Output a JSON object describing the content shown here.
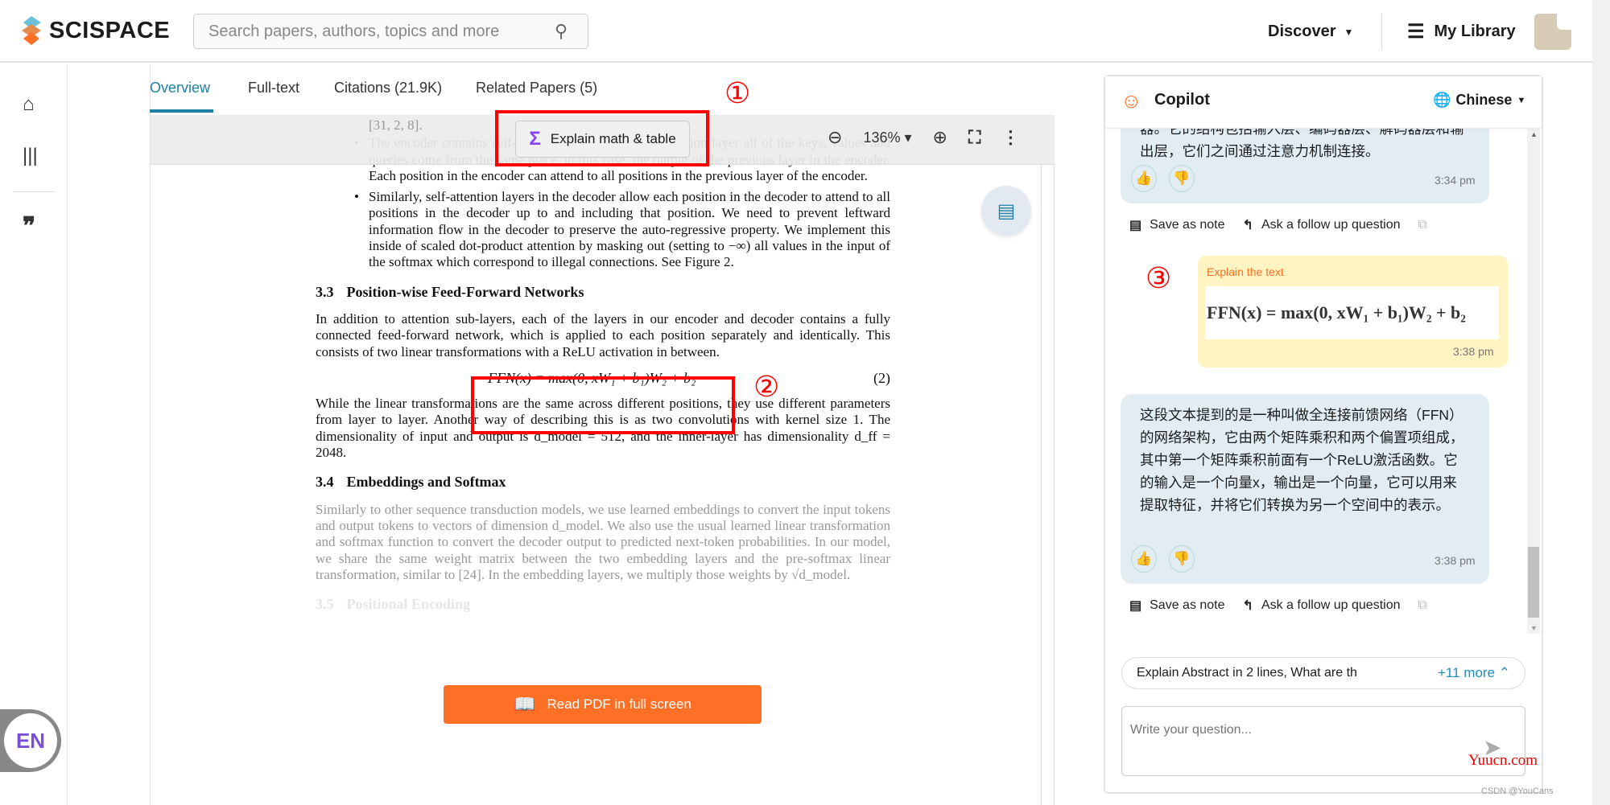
{
  "header": {
    "brand": "SCISPACE",
    "search_placeholder": "Search papers, authors, topics and more",
    "discover": "Discover",
    "my_library": "My Library"
  },
  "sidebar": {
    "icons": [
      "home-icon",
      "library-icon",
      "quote-icon"
    ],
    "language_badge": "EN"
  },
  "tabs": [
    {
      "label": "Overview",
      "active": true
    },
    {
      "label": "Full-text"
    },
    {
      "label": "Citations (21.9K)"
    },
    {
      "label": "Related Papers (5)"
    }
  ],
  "toolbar": {
    "explain_button": "Explain math & table",
    "zoom_level": "136%"
  },
  "annotations": {
    "m1": "①",
    "m2": "②",
    "m3": "③"
  },
  "pdf": {
    "ref_line": "[31, 2, 8].",
    "bullet1": "The encoder contains self-attention layers. In a self-attention layer all of the keys, values and queries come from the same place, in this case, the output of the previous layer in the encoder. Each position in the encoder can attend to all positions in the previous layer of the encoder.",
    "bullet2": "Similarly, self-attention layers in the decoder allow each position in the decoder to attend to all positions in the decoder up to and including that position. We need to prevent leftward information flow in the decoder to preserve the auto-regressive property. We implement this inside of scaled dot-product attention by masking out (setting to −∞) all values in the input of the softmax which correspond to illegal connections. See Figure 2.",
    "sec33_num": "3.3",
    "sec33_title": "Position-wise Feed-Forward Networks",
    "p33": "In addition to attention sub-layers, each of the layers in our encoder and decoder contains a fully connected feed-forward network, which is applied to each position separately and identically. This consists of two linear transformations with a ReLU activation in between.",
    "equation": "FFN(x) = max(0, xW₁ + b₁)W₂ + b₂",
    "eq_num": "(2)",
    "p33b": "While the linear transformations are the same across different positions, they use different parameters from layer to layer. Another way of describing this is as two convolutions with kernel size 1. The dimensionality of input and output is d_model = 512, and the inner-layer has dimensionality d_ff = 2048.",
    "sec34_num": "3.4",
    "sec34_title": "Embeddings and Softmax",
    "p34": "Similarly to other sequence transduction models, we use learned embeddings to convert the input tokens and output tokens to vectors of dimension d_model. We also use the usual learned linear transformation and softmax function to convert the decoder output to predicted next-token probabilities. In our model, we share the same weight matrix between the two embedding layers and the pre-softmax linear transformation, similar to [24]. In the embedding layers, we multiply those weights by √d_model.",
    "sec35_num": "3.5",
    "sec35_title": "Positional Encoding"
  },
  "read_pdf_button": "Read PDF in full screen",
  "copilot": {
    "title": "Copilot",
    "language": "Chinese",
    "messages": [
      {
        "text": "器。它的结构包括输入层、编码器层、解码器层和输出层，它们之间通过注意力机制连接。",
        "time": "3:34 pm"
      },
      {
        "label": "Explain the text",
        "formula": "FFN(x) = max(0, xW₁ + b₁)W₂ + b₂",
        "time": "3:38 pm"
      },
      {
        "text": "这段文本提到的是一种叫做全连接前馈网络（FFN）的网络架构，它由两个矩阵乘积和两个偏置项组成，其中第一个矩阵乘积前面有一个ReLU激活函数。它的输入是一个向量x，输出是一个向量，它可以用来提取特征，并将它们转换为另一个空间中的表示。",
        "time": "3:38 pm"
      }
    ],
    "save_note": "Save as note",
    "follow_up": "Ask a follow up question",
    "suggestion": "Explain Abstract in 2 lines, What are th",
    "more": "+11 more",
    "input_placeholder": "Write your question..."
  },
  "watermarks": {
    "site": "Yuucn.com",
    "csdn": "CSDN @YouCans"
  },
  "colors": {
    "accent": "#1f80a6",
    "orange": "#ff7026",
    "annotation": "#ff0000",
    "bubble": "#e1edf3",
    "user_bubble": "#fff4c2"
  }
}
